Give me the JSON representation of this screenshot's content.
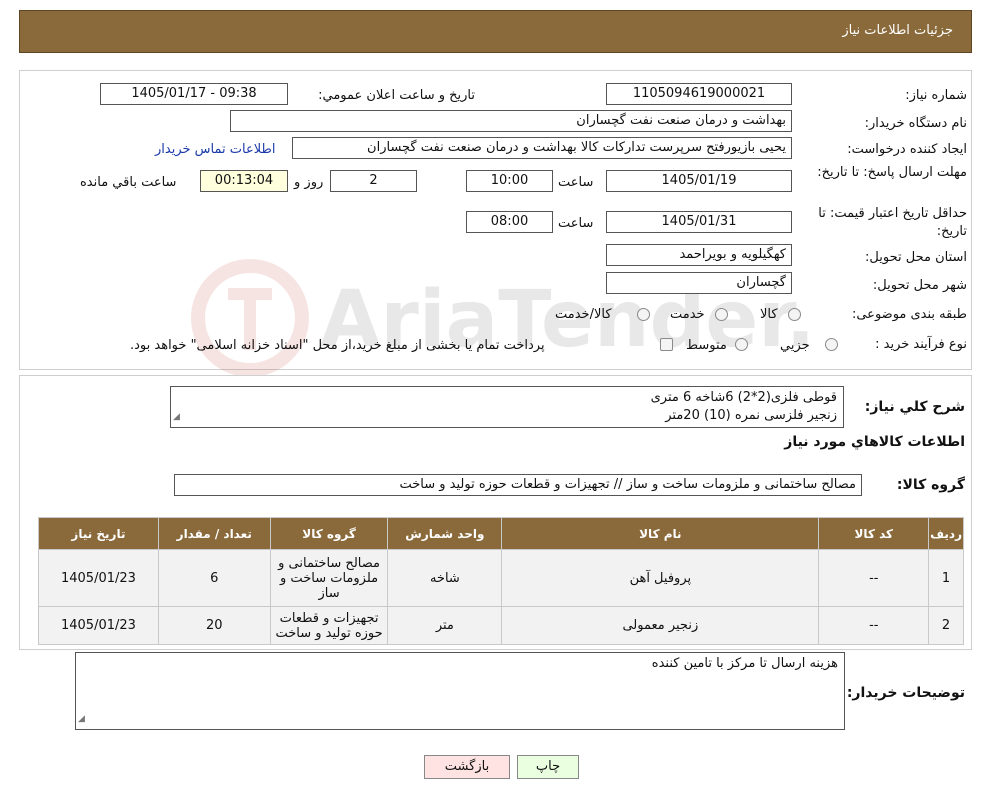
{
  "header": {
    "title": "جزئیات اطلاعات نیاز"
  },
  "form": {
    "need_number": {
      "label": "شماره نیاز:",
      "value": "1105094619000021"
    },
    "announce_datetime": {
      "label": "تاریخ و ساعت اعلان عمومي:",
      "value": "1405/01/17 - 09:38"
    },
    "buyer_org": {
      "label": "نام دستگاه خريدار:",
      "value": "بهداشت و درمان صنعت نفت گچساران"
    },
    "creator": {
      "label": "ايجاد کننده درخواست:",
      "value": "یحیی بازیورفتح سرپرست تدارکات کالا  بهداشت و درمان صنعت نفت گچساران",
      "contact_link": "اطلاعات تماس خريدار"
    },
    "reply_deadline": {
      "label": "مهلت ارسال پاسخ: تا تاريخ:",
      "date": "1405/01/19",
      "time_label": "ساعت",
      "time": "10:00",
      "days": "2",
      "days_label": "روز و",
      "remaining": "00:13:04",
      "remaining_label": "ساعت باقي مانده"
    },
    "price_validity": {
      "label": "حداقل تاريخ اعتبار قيمت: تا تاريخ:",
      "date": "1405/01/31",
      "time_label": "ساعت",
      "time": "08:00"
    },
    "province": {
      "label": "استان محل تحويل:",
      "value": "کهگیلویه و بویراحمد"
    },
    "city": {
      "label": "شهر محل تحويل:",
      "value": "گچساران"
    },
    "category": {
      "label": "طبقه بندی موضوعی:",
      "options": [
        "کالا",
        "خدمت",
        "کالا/خدمت"
      ]
    },
    "process": {
      "label": "نوع فرآيند خريد :",
      "options": [
        "جزيي",
        "متوسط"
      ],
      "note": "پرداخت تمام يا بخشی از مبلغ خريد،از محل \"اسناد خزانه اسلامی\" خواهد بود."
    }
  },
  "summary": {
    "label": "شرح کلي نياز:",
    "lines": [
      "قوطی فلزی(2*2) 6شاخه 6 متری",
      "زنجیر فلزسی نمره (10) 20متر"
    ]
  },
  "goods": {
    "section_title": "اطلاعات کالاهاي مورد نياز",
    "group_label": "گروه کالا:",
    "group_value": "مصالح ساختمانی و ملزومات ساخت و ساز // تجهیزات و قطعات حوزه تولید و ساخت",
    "columns": [
      "رديف",
      "کد کالا",
      "نام کالا",
      "واحد شمارش",
      "گروه کالا",
      "تعداد / مقدار",
      "تاريخ نياز"
    ],
    "rows": [
      {
        "index": "1",
        "code": "--",
        "name": "پروفیل آهن",
        "unit": "شاخه",
        "group": "مصالح ساختمانی و ملزومات ساخت و ساز",
        "qty": "6",
        "date": "1405/01/23"
      },
      {
        "index": "2",
        "code": "--",
        "name": "زنجیر معمولی",
        "unit": "متر",
        "group": "تجهیزات و قطعات حوزه تولید و ساخت",
        "qty": "20",
        "date": "1405/01/23"
      }
    ]
  },
  "buyer_notes": {
    "label": "توضيحات خريدار:",
    "value": "هزینه ارسال تا مرکز با تامین کننده"
  },
  "buttons": {
    "print": "چاپ",
    "back": "بازگشت"
  },
  "watermark": {
    "text": "AriaTender.neT"
  },
  "colors": {
    "header_bg": "#8a6a3a",
    "print_bg": "#eaffe0",
    "back_bg": "#ffe3e3",
    "link": "#1a3aa8"
  }
}
